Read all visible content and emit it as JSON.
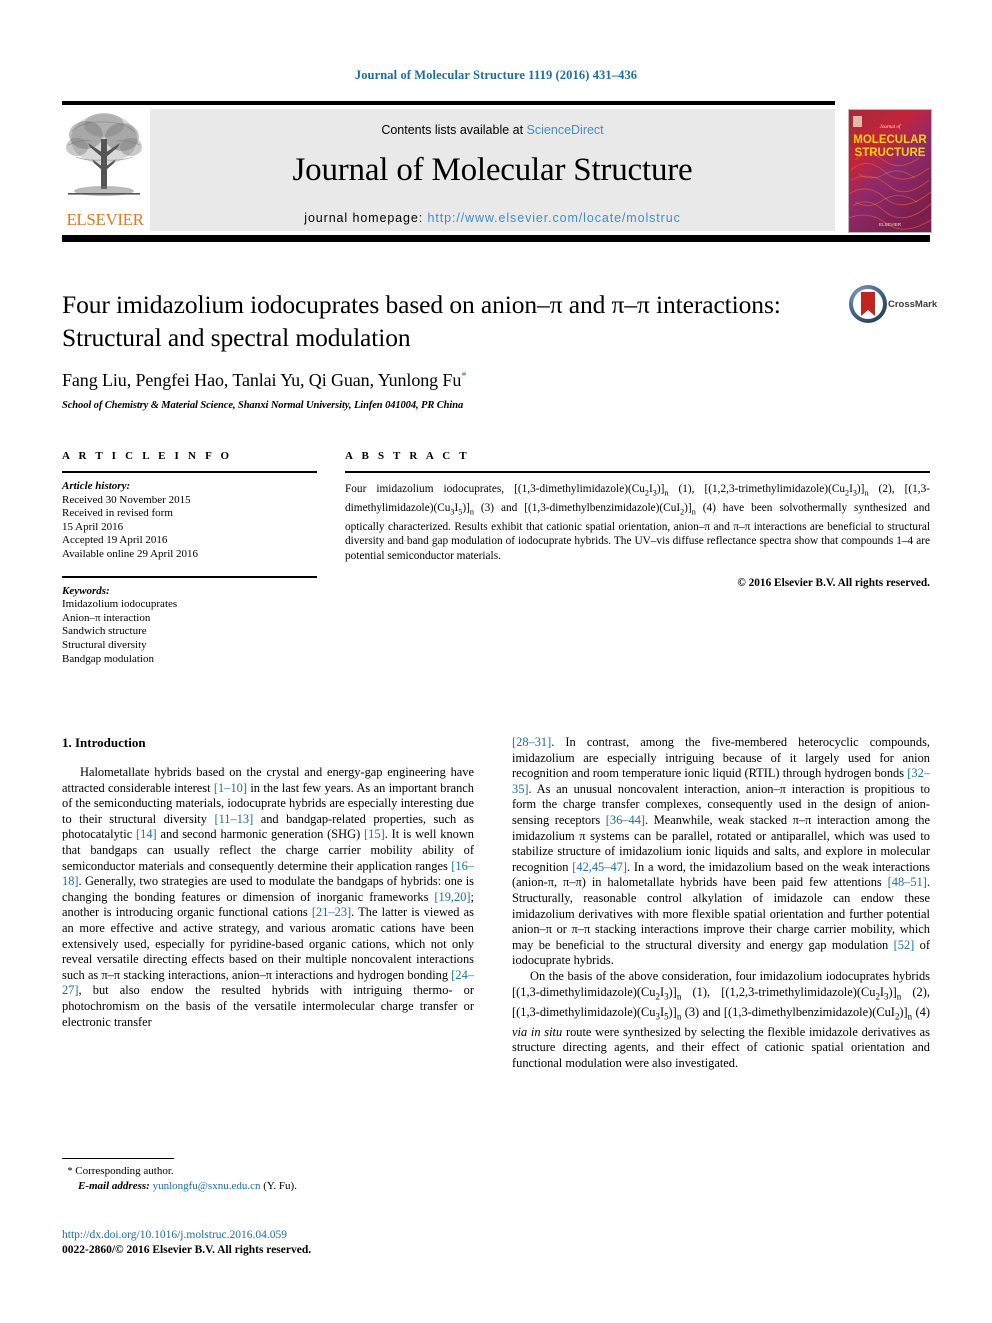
{
  "running_head": "Journal of Molecular Structure 1119 (2016) 431–436",
  "masthead": {
    "contents_prefix": "Contents lists available at ",
    "sciencedirect": "ScienceDirect",
    "journal_title": "Journal of Molecular Structure",
    "homepage_label": "journal homepage: ",
    "homepage_url": "http://www.elsevier.com/locate/molstruc",
    "publisher": "ELSEVIER",
    "cover_line1": "Journal of",
    "cover_line2": "MOLECULAR",
    "cover_line3": "STRUCTURE",
    "cover_publisher": "ELSEVIER"
  },
  "article": {
    "title": "Four imidazolium iodocuprates based on anion–π and π–π interactions: Structural and spectral modulation",
    "authors": "Fang Liu, Pengfei Hao, Tanlai Yu, Qi Guan, Yunlong Fu",
    "corresponding_marker": "*",
    "affiliation": "School of Chemistry & Material Science, Shanxi Normal University, Linfen 041004, PR China",
    "crossmark_label": "CrossMark"
  },
  "info": {
    "heading": "A R T I C L E   I N F O",
    "history_label": "Article history:",
    "history_lines": [
      "Received 30 November 2015",
      "Received in revised form",
      "15 April 2016",
      "Accepted 19 April 2016",
      "Available online 29 April 2016"
    ],
    "keywords_label": "Keywords:",
    "keywords": [
      "Imidazolium iodocuprates",
      "Anion–π interaction",
      "Sandwich structure",
      "Structural diversity",
      "Bandgap modulation"
    ]
  },
  "abstract": {
    "heading": "A B S T R A C T",
    "text": "Four imidazolium iodocuprates, [(1,3-dimethylimidazole)(Cu2I3)]n (1), [(1,2,3-trimethylimidazole)(Cu2I3)]n (2), [(1,3-dimethylimidazole)(Cu3I5)]n (3) and [(1,3-dimethylbenzimidazole)(CuI2)]n (4) have been solvothermally synthesized and optically characterized. Results exhibit that cationic spatial orientation, anion–π and π–π interactions are beneficial to structural diversity and band gap modulation of iodocuprate hybrids. The UV–vis diffuse reflectance spectra show that compounds 1–4 are potential semiconductor materials.",
    "copyright": "© 2016 Elsevier B.V. All rights reserved."
  },
  "body": {
    "section_number_title": "1. Introduction",
    "left_paragraph": "Halometallate hybrids based on the crystal and energy-gap engineering have attracted considerable interest [1–10] in the last few years. As an important branch of the semiconducting materials, iodocuprate hybrids are especially interesting due to their structural diversity [11–13] and bandgap-related properties, such as photocatalytic [14] and second harmonic generation (SHG) [15]. It is well known that bandgaps can usually reflect the charge carrier mobility ability of semiconductor materials and consequently determine their application ranges [16–18]. Generally, two strategies are used to modulate the bandgaps of hybrids: one is changing the bonding features or dimension of inorganic frameworks [19,20]; another is introducing organic functional cations [21–23]. The latter is viewed as an more effective and active strategy, and various aromatic cations have been extensively used, especially for pyridine-based organic cations, which not only reveal versatile directing effects based on their multiple noncovalent interactions such as π–π stacking interactions, anion–π interactions and hydrogen bonding [24–27], but also endow the resulted hybrids with intriguing thermo- or photochromism on the basis of the versatile intermolecular charge transfer or electronic transfer",
    "right_paragraph_1": "[28–31]. In contrast, among the five-membered heterocyclic compounds, imidazolium are especially intriguing because of it largely used for anion recognition and room temperature ionic liquid (RTIL) through hydrogen bonds [32–35]. As an unusual noncovalent interaction, anion–π interaction is propitious to form the charge transfer complexes, consequently used in the design of anion-sensing receptors [36–44]. Meanwhile, weak stacked π–π interaction among the imidazolium π systems can be parallel, rotated or antiparallel, which was used to stabilize structure of imidazolium ionic liquids and salts, and explore in molecular recognition [42,45–47]. In a word, the imidazolium based on the weak interactions (anion-π, π–π) in halometallate hybrids have been paid few attentions [48–51]. Structurally, reasonable control alkylation of imidazole can endow these imidazolium derivatives with more flexible spatial orientation and further potential anion–π or π–π stacking interactions improve their charge carrier mobility, which may be beneficial to the structural diversity and energy gap modulation [52] of iodocuprate hybrids.",
    "right_paragraph_2": "On the basis of the above consideration, four imidazolium iodocuprates hybrids [(1,3-dimethylimidazole)(Cu2I3)]n (1), [(1,2,3-trimethylimidazole)(Cu2I3)]n (2), [(1,3-dimethylimidazole)(Cu3I5)]n (3) and [(1,3-dimethylbenzimidazole)(CuI2)]n (4) via in situ route were synthesized by selecting the flexible imidazole derivatives as structure directing agents, and their effect of cationic spatial orientation and functional modulation were also investigated."
  },
  "footnotes": {
    "corresponding_star": "*",
    "corresponding_text": "Corresponding author.",
    "email_label": "E-mail address:",
    "email": "yunlongfu@sxnu.edu.cn",
    "email_suffix": "(Y. Fu).",
    "doi": "http://dx.doi.org/10.1016/j.molstruc.2016.04.059",
    "issn_line": "0022-2860/© 2016 Elsevier B.V. All rights reserved."
  },
  "colors": {
    "link_blue": "#1a6ea8",
    "sd_blue": "#3f8fc5",
    "elsevier_orange": "#e87722",
    "masthead_gray": "#e9e9e9"
  }
}
